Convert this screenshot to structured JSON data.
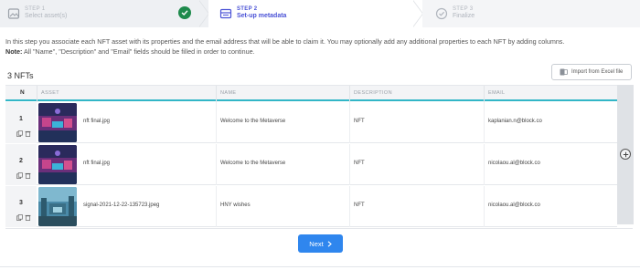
{
  "stepper": {
    "step1": {
      "num": "STEP 1",
      "label": "Select asset(s)"
    },
    "step2": {
      "num": "STEP 2",
      "label": "Set-up metadata"
    },
    "step3": {
      "num": "STEP 3",
      "label": "Finalize"
    }
  },
  "intro": {
    "line1": "In this step you associate each NFT asset with its properties and the email address that will be able to claim it. You may optionally add any additional properties to each NFT by adding columns.",
    "note_label": "Note:",
    "note_text": " All \"Name\", \"Description\" and \"Email\" fields should be filled in order to continue."
  },
  "nft_count": "3 NFTs",
  "import_button": "Import from Excel file",
  "table": {
    "headers": {
      "n": "N",
      "asset": "ASSET",
      "name": "NAME",
      "description": "DESCRIPTION",
      "email": "EMAIL"
    },
    "rows": [
      {
        "n": "1",
        "asset": "nft final.jpg",
        "name": "Welcome to the Metaverse",
        "description": "NFT",
        "email": "kaplanian.n@block.co"
      },
      {
        "n": "2",
        "asset": "nft final.jpg",
        "name": "Welcome to the Metaverse",
        "description": "NFT",
        "email": "nicolaou.al@block.co"
      },
      {
        "n": "3",
        "asset": "signal-2021-12-22-135723.jpeg",
        "name": "HNY wishes",
        "description": "NFT",
        "email": "nicolaou.al@block.co"
      }
    ]
  },
  "next_button": "Next",
  "colors": {
    "accent": "#2f86ee",
    "step_active": "#4a52d6",
    "success": "#1e8a4c",
    "header_rule": "#32b6c7"
  }
}
